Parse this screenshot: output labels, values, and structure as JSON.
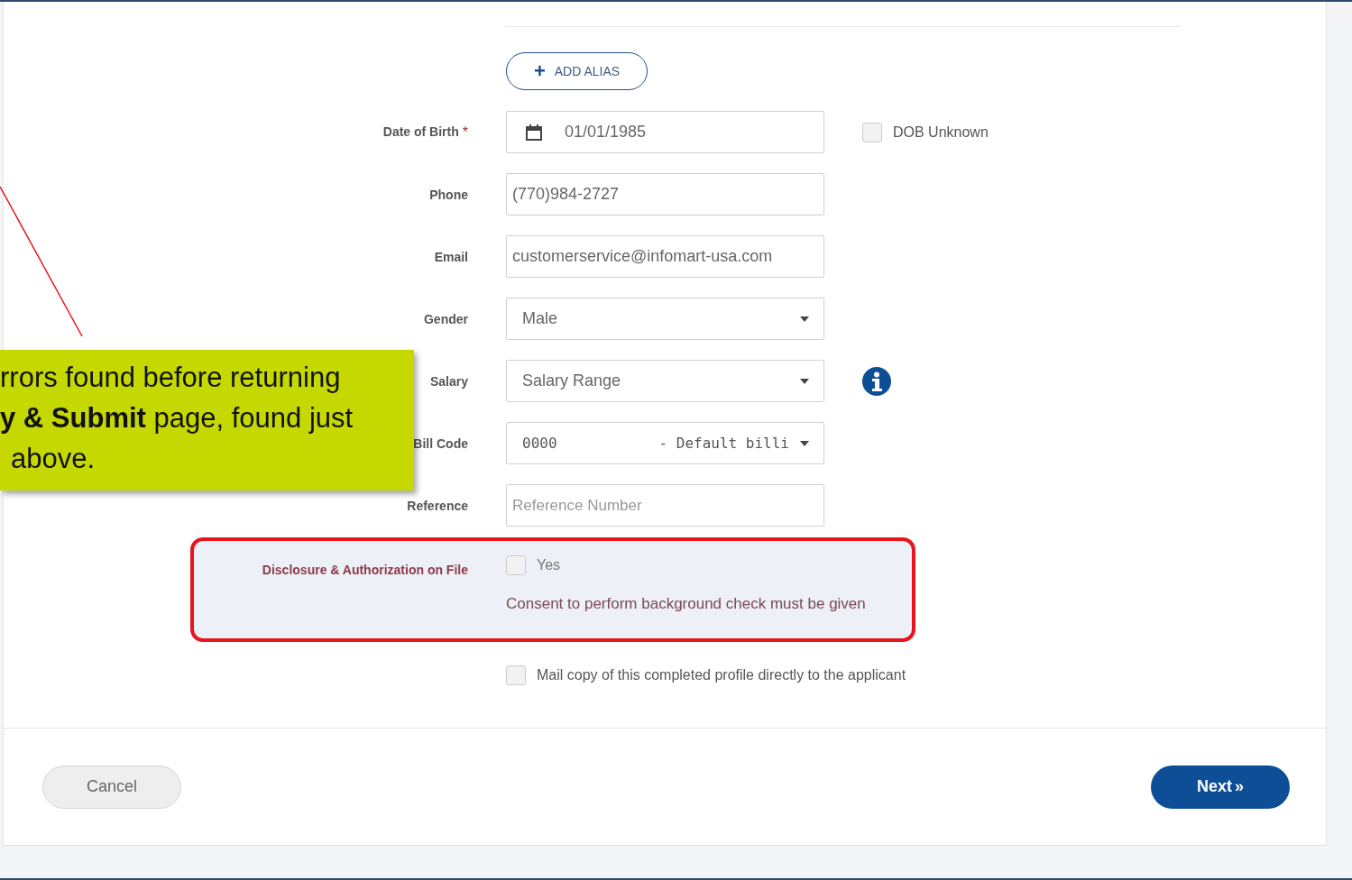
{
  "add_alias_button": {
    "icon": "+",
    "label": "ADD ALIAS"
  },
  "fields": [
    {
      "kind": "date",
      "label": "Date of Birth",
      "required_mark": "*",
      "value": "01/01/1985",
      "side": {
        "kind": "checkbox",
        "label": "DOB Unknown",
        "checked": false
      }
    },
    {
      "kind": "text",
      "label": "Phone",
      "value": "(770)984-2727"
    },
    {
      "kind": "text",
      "label": "Email",
      "value": "customerservice@infomart-usa.com"
    },
    {
      "kind": "select",
      "label": "Gender",
      "value": "Male"
    },
    {
      "kind": "select",
      "label": "Salary",
      "value": "Salary Range",
      "side": {
        "kind": "info"
      }
    },
    {
      "kind": "select-mono",
      "label": "Bill Code",
      "value": "0000",
      "value_suffix": "- Default billi"
    },
    {
      "kind": "text",
      "label": "Reference",
      "placeholder": "Reference Number"
    }
  ],
  "disclosure": {
    "label": "Disclosure & Authorization on File",
    "option": {
      "label": "Yes",
      "checked": false
    },
    "error": "Consent to perform background check must be given"
  },
  "mail_copy": {
    "label": "Mail copy of this completed profile directly to the applicant",
    "checked": false
  },
  "buttons": {
    "cancel": "Cancel",
    "next": "Next",
    "next_icon": "»"
  },
  "callout": {
    "lines": [
      "rrors found before returning",
      "**y & Submit** page, found just",
      "above."
    ]
  }
}
